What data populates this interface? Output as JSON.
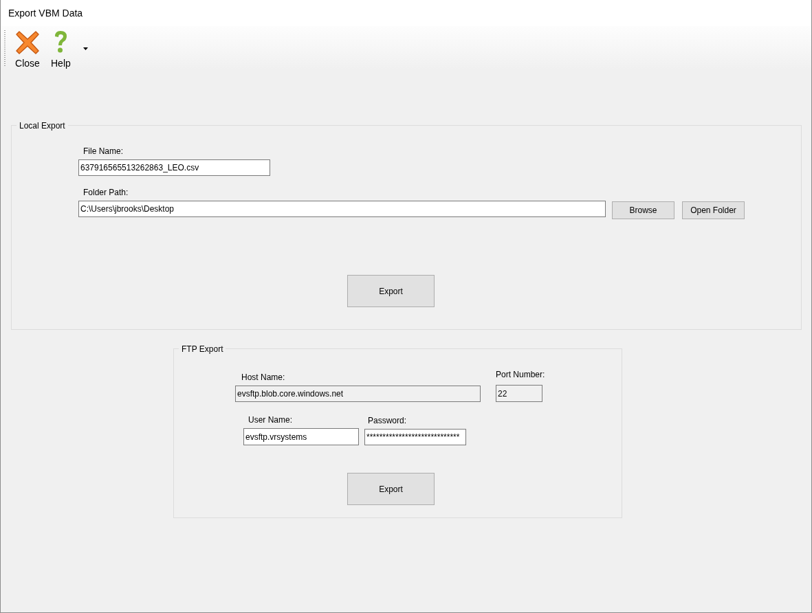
{
  "window": {
    "title": "Export VBM Data"
  },
  "toolbar": {
    "buttons": [
      {
        "label": "Close",
        "kind": "close"
      },
      {
        "label": "Help",
        "kind": "help"
      }
    ],
    "has_dropdown": true
  },
  "local_export": {
    "title": "Local Export",
    "file_name": {
      "label": "File Name:",
      "value": "637916565513262863_LEO.csv"
    },
    "folder_path": {
      "label": "Folder Path:",
      "value": "C:\\Users\\jbrooks\\Desktop"
    },
    "buttons": [
      "Browse",
      "Open Folder"
    ],
    "export_button": "Export"
  },
  "ftp_export": {
    "title": "FTP Export",
    "host_name": {
      "label": "Host Name:",
      "value": "evsftp.blob.core.windows.net",
      "readonly": true
    },
    "port_number": {
      "label": "Port Number:",
      "value": "22",
      "readonly": true
    },
    "user_name": {
      "label": "User Name:",
      "value": "evsftp.vrsystems",
      "readonly": false
    },
    "password": {
      "label": "Password:",
      "value": "*****************************",
      "readonly": false
    },
    "export_button": "Export"
  }
}
